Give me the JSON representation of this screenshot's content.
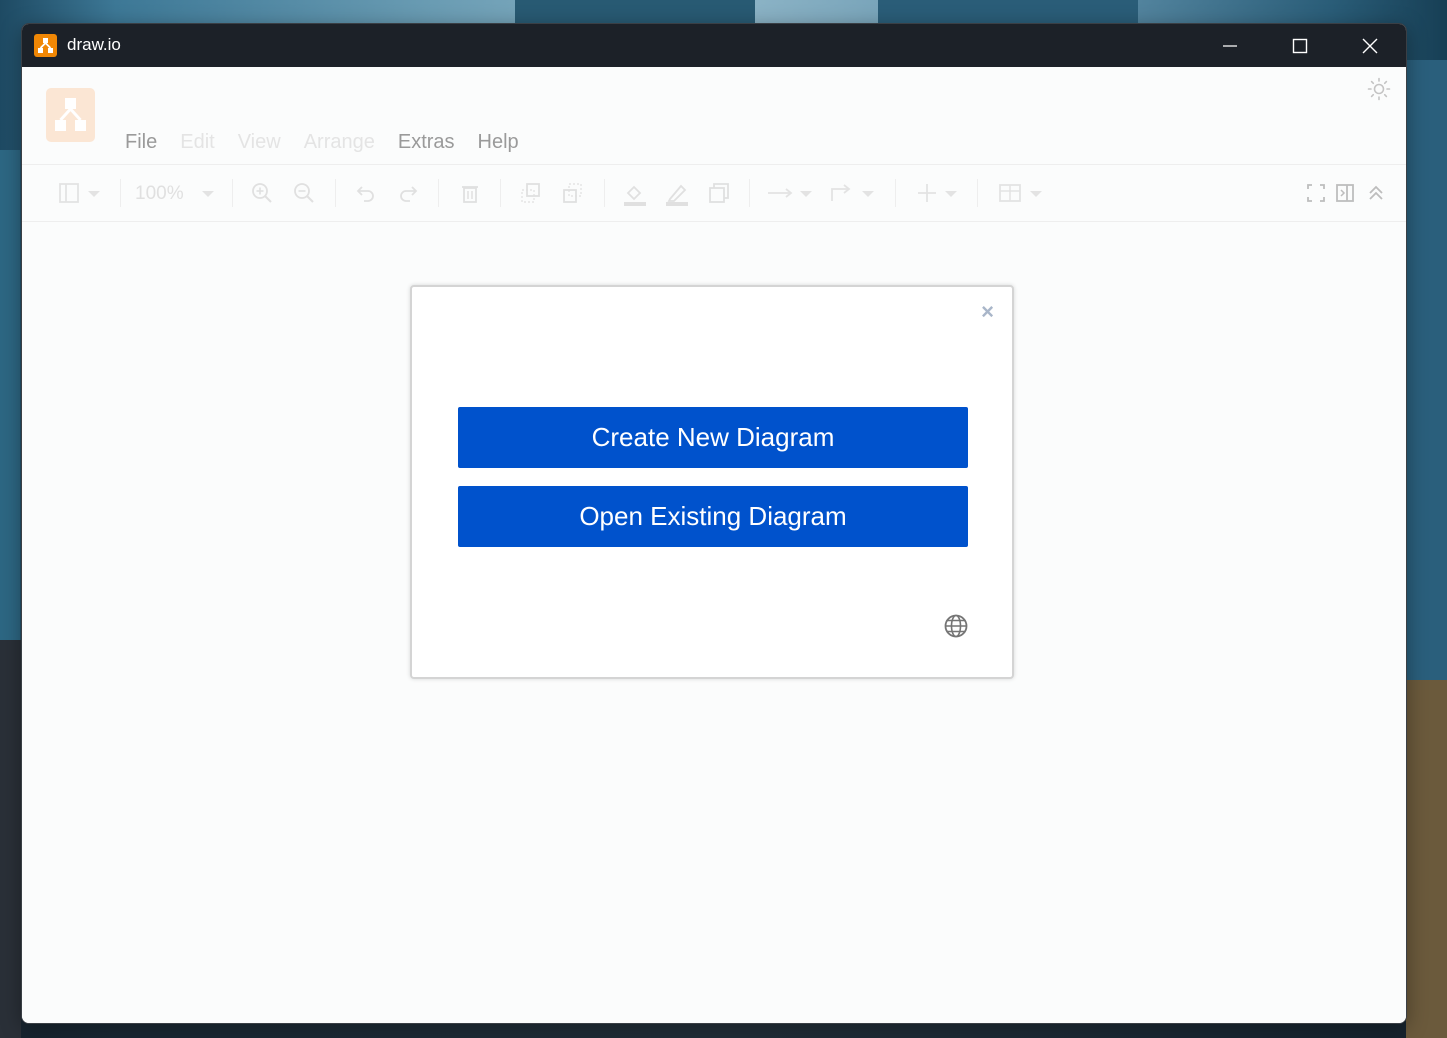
{
  "window": {
    "title": "draw.io"
  },
  "menu": {
    "items": [
      {
        "label": "File",
        "enabled": true
      },
      {
        "label": "Edit",
        "enabled": false
      },
      {
        "label": "View",
        "enabled": false
      },
      {
        "label": "Arrange",
        "enabled": false
      },
      {
        "label": "Extras",
        "enabled": true
      },
      {
        "label": "Help",
        "enabled": true
      }
    ]
  },
  "toolbar": {
    "zoom": "100%"
  },
  "dialog": {
    "close_symbol": "×",
    "create_label": "Create New Diagram",
    "open_label": "Open Existing Diagram"
  },
  "colors": {
    "accent": "#0052cc",
    "brand": "#f08705",
    "titlebar": "#1c2128"
  },
  "icons": {
    "app": "drawio-logo-icon",
    "theme": "sun-icon",
    "language": "globe-icon"
  }
}
